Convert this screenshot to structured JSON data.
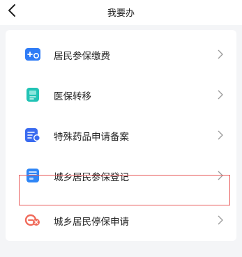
{
  "header": {
    "title": "我要办",
    "back_icon": "chevron-left-icon"
  },
  "menu": {
    "items": [
      {
        "label": "居民参保缴费",
        "icon": "insurance-payment-icon",
        "color": "#2f7cf6"
      },
      {
        "label": "医保转移",
        "icon": "insurance-transfer-icon",
        "color": "#22c3b5"
      },
      {
        "label": "特殊药品申请备案",
        "icon": "special-drug-icon",
        "color": "#3a6bf0"
      },
      {
        "label": "城乡居民参保登记",
        "icon": "registration-icon",
        "color": "#2f86f6"
      },
      {
        "label": "城乡居民停保申请",
        "icon": "suspend-insurance-icon",
        "color": "#f06a5a",
        "highlighted": true
      }
    ]
  }
}
